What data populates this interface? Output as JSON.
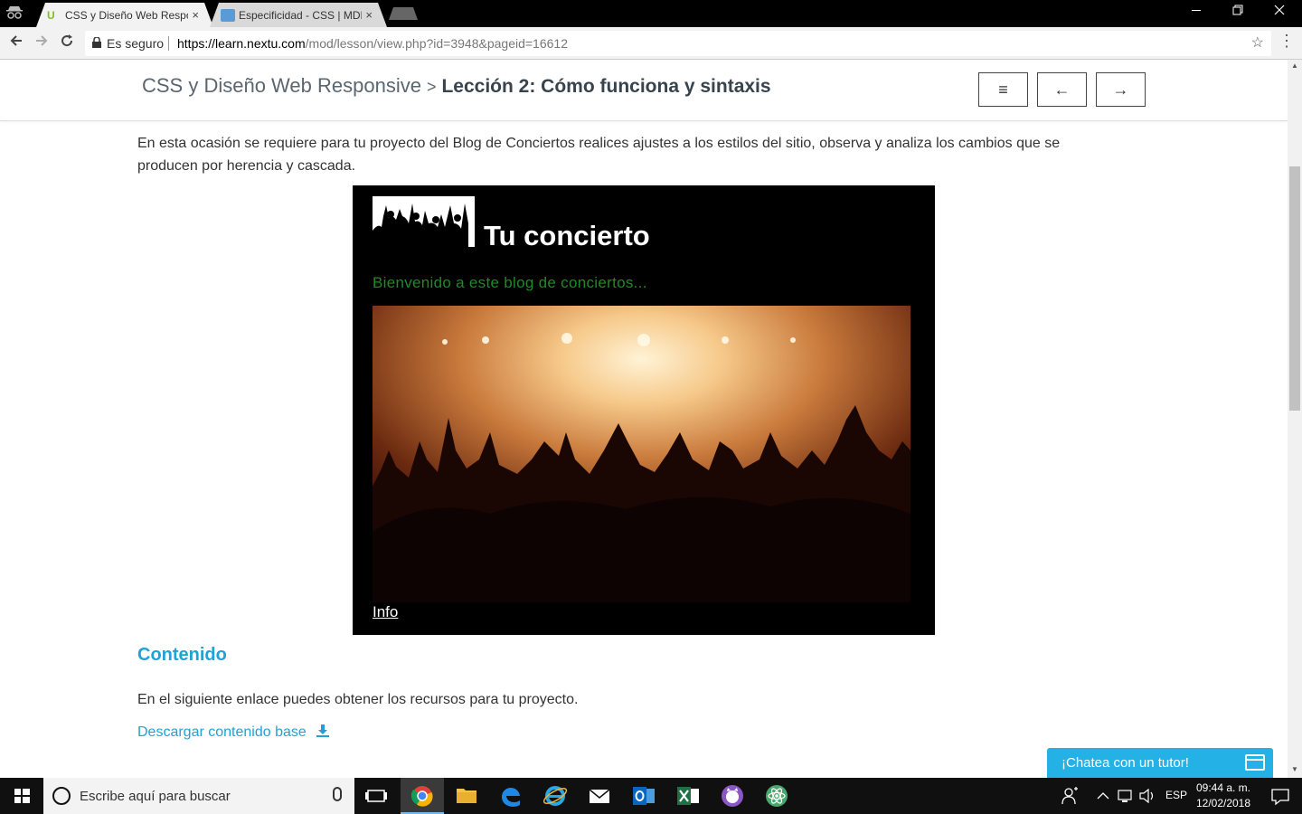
{
  "browser": {
    "tabs": [
      {
        "title": "CSS y Diseño Web Responsive",
        "active": true
      },
      {
        "title": "Especificidad - CSS | MDN",
        "active": false
      }
    ],
    "close_glyph": "×",
    "secure_label": "Es seguro",
    "url_host": "https://learn.nextu.com",
    "url_path": "/mod/lesson/view.php?id=3948&pageid=16612"
  },
  "header": {
    "course": "CSS y Diseño Web Responsive",
    "separator": ">",
    "lesson": "Lección 2: Cómo funciona y sintaxis",
    "menu_glyph": "≡",
    "prev_glyph": "←",
    "next_glyph": "→"
  },
  "content": {
    "intro": "En esta ocasión se requiere para tu proyecto del Blog de Conciertos realices ajustes a los estilos del sitio, observa y analiza los cambios que se producen por herencia y cascada.",
    "preview": {
      "site_title": "Tu concierto",
      "welcome": "Bienvenido a este blog de conciertos...",
      "info_link": "Info"
    },
    "section_heading": "Contenido",
    "resources_text": "En el siguiente enlace puedes obtener los recursos para tu proyecto.",
    "download_link": "Descargar contenido base",
    "chat_label": "¡Chatea con un tutor!"
  },
  "taskbar": {
    "search_placeholder": "Escribe aquí para buscar",
    "language": "ESP",
    "time": "09:44 a. m.",
    "date": "12/02/2018"
  },
  "colors": {
    "accent": "#1fa3d6",
    "welcome_green": "#1e8a2a",
    "chat_bg": "#23b1e6"
  }
}
